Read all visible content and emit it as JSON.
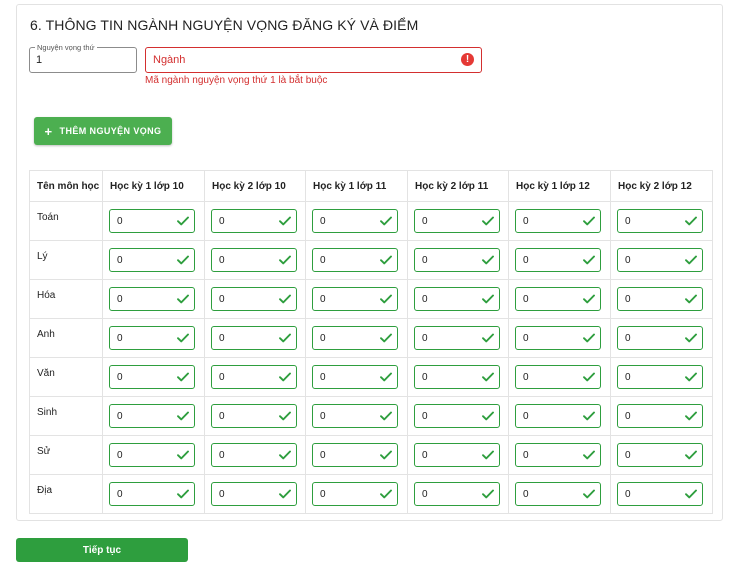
{
  "section": {
    "title": "6. THÔNG TIN NGÀNH NGUYỆN VỌNG ĐĂNG KÝ VÀ ĐIỂM"
  },
  "wish": {
    "label": "Nguyện vọng thứ",
    "value": "1"
  },
  "major": {
    "placeholder": "Ngành",
    "error": "Mã ngành nguyện vọng thứ 1 là bắt buộc",
    "error_icon": "!"
  },
  "add_button": {
    "icon": "+",
    "label": "THÊM NGUYỆN VỌNG"
  },
  "table": {
    "headers": [
      "Tên môn học",
      "Học kỳ 1 lớp 10",
      "Học kỳ 2 lớp 10",
      "Học kỳ 1 lớp 11",
      "Học kỳ 2 lớp 11",
      "Học kỳ 1 lớp 12",
      "Học kỳ 2 lớp 12"
    ],
    "rows": [
      {
        "subject": "Toán",
        "scores": [
          "0",
          "0",
          "0",
          "0",
          "0",
          "0"
        ]
      },
      {
        "subject": "Lý",
        "scores": [
          "0",
          "0",
          "0",
          "0",
          "0",
          "0"
        ]
      },
      {
        "subject": "Hóa",
        "scores": [
          "0",
          "0",
          "0",
          "0",
          "0",
          "0"
        ]
      },
      {
        "subject": "Anh",
        "scores": [
          "0",
          "0",
          "0",
          "0",
          "0",
          "0"
        ]
      },
      {
        "subject": "Văn",
        "scores": [
          "0",
          "0",
          "0",
          "0",
          "0",
          "0"
        ]
      },
      {
        "subject": "Sinh",
        "scores": [
          "0",
          "0",
          "0",
          "0",
          "0",
          "0"
        ]
      },
      {
        "subject": "Sử",
        "scores": [
          "0",
          "0",
          "0",
          "0",
          "0",
          "0"
        ]
      },
      {
        "subject": "Địa",
        "scores": [
          "0",
          "0",
          "0",
          "0",
          "0",
          "0"
        ]
      }
    ]
  },
  "submit_button": {
    "label": "Tiếp tục"
  },
  "colors": {
    "success": "#2e9e3e",
    "error": "#d32f2f",
    "add_button": "#4caf50"
  },
  "icons": {
    "valid": "check-icon",
    "error": "error-icon",
    "add": "plus-icon"
  }
}
